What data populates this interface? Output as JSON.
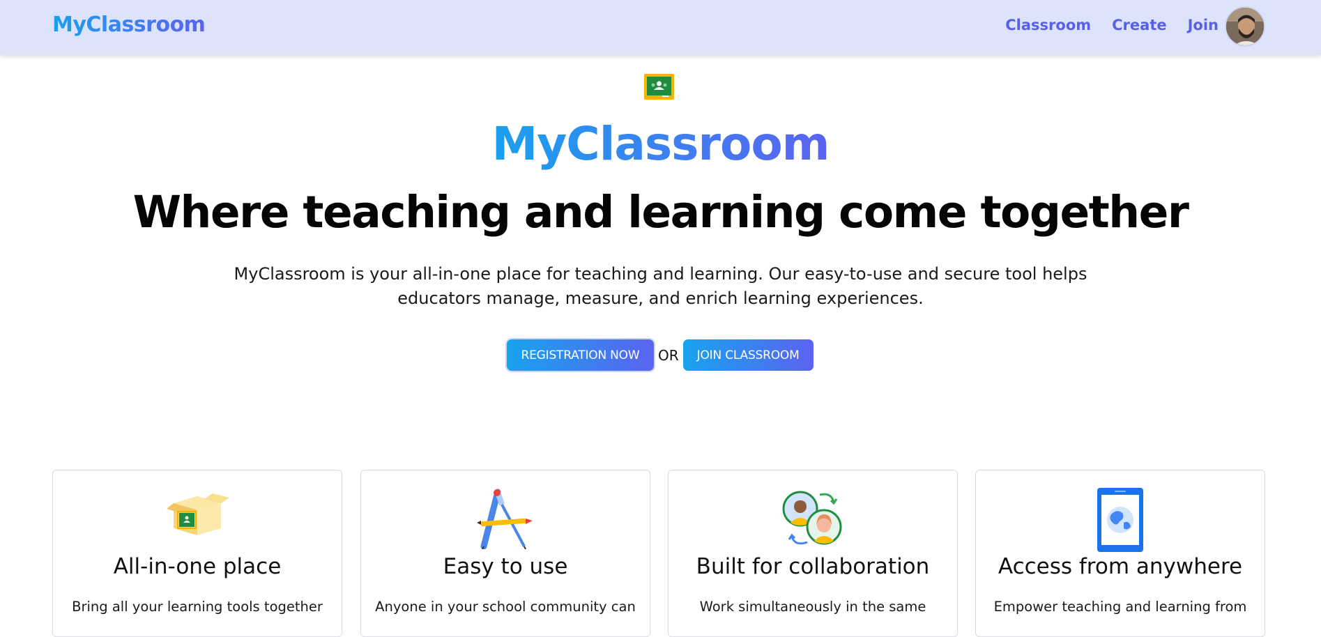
{
  "navbar": {
    "brand": "MyClassroom",
    "links": [
      {
        "label": "Classroom"
      },
      {
        "label": "Create"
      },
      {
        "label": "Join"
      }
    ]
  },
  "hero": {
    "title": "MyClassroom",
    "headline": "Where teaching and learning come together",
    "description": "MyClassroom is your all-in-one place for teaching and learning. Our easy-to-use and secure tool helps educators manage, measure, and enrich learning experiences.",
    "register_label": "REGISTRATION NOW",
    "or_label": "OR",
    "join_label": "JOIN CLASSROOM"
  },
  "features": [
    {
      "icon": "box-icon",
      "title": "All-in-one place",
      "text": "Bring all your learning tools together"
    },
    {
      "icon": "compass-pencil-icon",
      "title": "Easy to use",
      "text": "Anyone in your school community can"
    },
    {
      "icon": "collaboration-people-icon",
      "title": "Built for collaboration",
      "text": "Work simultaneously in the same"
    },
    {
      "icon": "tablet-globe-icon",
      "title": "Access from anywhere",
      "text": "Empower teaching and learning from"
    }
  ],
  "colors": {
    "navbar_bg": "#dde3fb",
    "gradient_start": "#1aa0ef",
    "gradient_end": "#5b63f0",
    "nav_link": "#5860e4"
  }
}
